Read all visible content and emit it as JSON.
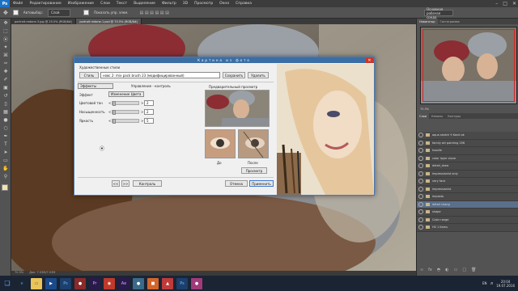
{
  "app": {
    "logo": "Ps"
  },
  "menubar": {
    "items": [
      "Файл",
      "Редактирование",
      "Изображение",
      "Слои",
      "Текст",
      "Выделение",
      "Фильтр",
      "3D",
      "Просмотр",
      "Окно",
      "Справка"
    ]
  },
  "options": {
    "auto_select": "Автовыбор:",
    "auto_select_value": "Слой",
    "transform": "Показать упр. элем.",
    "workspace": "Основная рабочая среда"
  },
  "tabs": [
    "portrait-redone-3.jpg @ 25.5% (RGB/8#)",
    "portrait redone-1.psd @ 70.5% (RGB/8#)"
  ],
  "status": {
    "zoom": "70.5%",
    "doc": "Док: 7.03M/7.03M"
  },
  "dialog": {
    "title": "Картина из фото",
    "artistic_styles_label": "Художественные стили",
    "style_button": "Стиль",
    "style_value": "новс 2: mix pack brush 23 (модифицированный)",
    "save_button": "Сохранить",
    "delete_button": "Удалить",
    "effects_select": "Эффекты",
    "management_label": "Управление - контроль",
    "effect_label": "Эффект",
    "effect_value": "Изменение Цвета",
    "hue_label": "Цветовой тон",
    "hue_value": "2",
    "saturation_label": "Насыщенность",
    "saturation_value": "2",
    "brightness_label": "Яркость",
    "brightness_value": "5",
    "preview_label": "Предварительный просмотр",
    "before_label": "До",
    "after_label": "После",
    "preview_button": "Просмотр",
    "control_button": "Контроль",
    "cancel_button": "Отмена",
    "apply_button": "Применить",
    "nav_prev": "<<",
    "nav_next": ">>"
  },
  "panels": {
    "nav_tabs": [
      "Навигатор",
      "Гистограмма"
    ],
    "layers_tabs": [
      "Слои",
      "Каналы",
      "Контуры"
    ],
    "zoom": "70.5%",
    "layers": [
      "aqua sketch 9 Kand ok",
      "family art painting 256",
      "hoodie",
      "color layer clone",
      "detail_draw",
      "impressionist only",
      "very face",
      "impressionist",
      "impasto",
      "detail chang",
      "shape",
      "Color range",
      "HS 1 Kams"
    ]
  },
  "taskbar": {
    "lang": "EN",
    "time": "20:04",
    "date": "19.07.2016"
  },
  "colors": {
    "accent": "#3a6ea5",
    "ps_blue": "#1c73c5",
    "panel": "#535353",
    "close": "#c8372d"
  }
}
